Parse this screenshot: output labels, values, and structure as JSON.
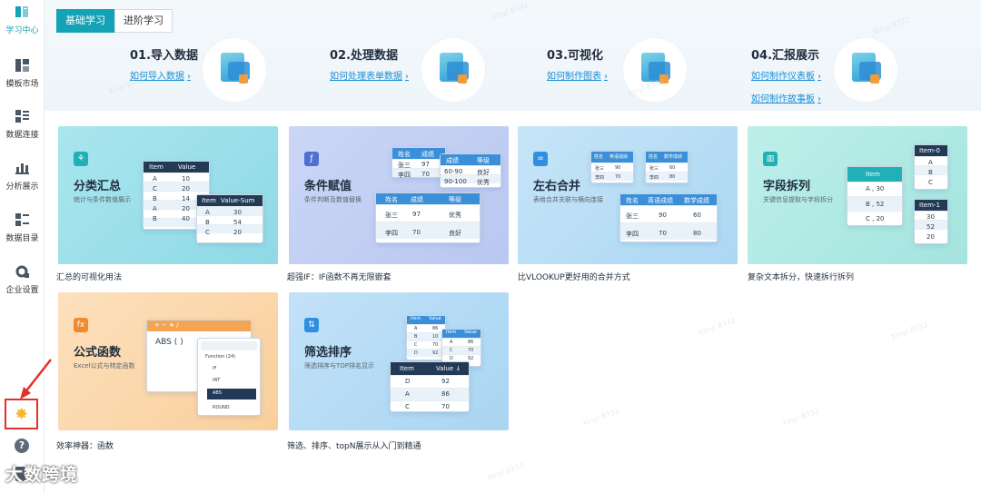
{
  "sidebar": {
    "items": [
      {
        "label": "学习中心",
        "icon": "book-icon",
        "active": true
      },
      {
        "label": "模板市场",
        "icon": "grid-icon",
        "active": false
      },
      {
        "label": "数据连接",
        "icon": "database-icon",
        "active": false
      },
      {
        "label": "分析展示",
        "icon": "chart-icon",
        "active": false
      },
      {
        "label": "数据目录",
        "icon": "list-icon",
        "active": false
      },
      {
        "label": "企业设置",
        "icon": "gear-icon",
        "active": false
      }
    ],
    "star_icon": "star-icon",
    "help_icon": "help-icon",
    "doc_icon": "document-icon"
  },
  "tabs": [
    {
      "label": "基础学习",
      "active": true
    },
    {
      "label": "进阶学习",
      "active": false
    }
  ],
  "steps": [
    {
      "title": "01.导入数据",
      "links": [
        "如何导入数据"
      ]
    },
    {
      "title": "02.处理数据",
      "links": [
        "如何处理表单数据"
      ]
    },
    {
      "title": "03.可视化",
      "links": [
        "如何制作图表"
      ]
    },
    {
      "title": "04.汇报展示",
      "links": [
        "如何制作仪表板",
        "如何制作故事板"
      ]
    }
  ],
  "cards": [
    {
      "title": "分类汇总",
      "subtitle": "统计与条件数值展示",
      "caption": "汇总的可视化用法",
      "badge": "⚘",
      "accent": "#20b0b5",
      "bg": "#9fe0e9",
      "tables": {
        "t1": {
          "headers": [
            "Item",
            "Value"
          ],
          "rows": [
            [
              "A",
              "10"
            ],
            [
              "C",
              "20"
            ],
            [
              "B",
              "14"
            ],
            [
              "A",
              "20"
            ],
            [
              "B",
              "40"
            ]
          ]
        },
        "t2": {
          "headers": [
            "Item",
            "Value-Sum"
          ],
          "rows": [
            [
              "A",
              "30"
            ],
            [
              "B",
              "54"
            ],
            [
              "C",
              "20"
            ]
          ]
        }
      }
    },
    {
      "title": "条件赋值",
      "subtitle": "条件判断及数值替换",
      "caption": "超强IF：IF函数不再无限嵌套",
      "badge": "f",
      "accent": "#4f6fd1",
      "bg": "#c5d2f5",
      "tables": {
        "t1": {
          "headers": [
            "姓名",
            "成绩"
          ],
          "rows": [
            [
              "张三",
              "97"
            ],
            [
              "李四",
              "70"
            ]
          ]
        },
        "t2": {
          "headers": [
            "成绩",
            "等级"
          ],
          "rows": [
            [
              "60-90",
              "良好"
            ],
            [
              "90-100",
              "优秀"
            ]
          ]
        },
        "t3": {
          "headers": [
            "姓名",
            "成绩",
            "等级"
          ],
          "rows": [
            [
              "张三",
              "97",
              "优秀"
            ],
            [
              "李四",
              "70",
              "良好"
            ]
          ]
        }
      }
    },
    {
      "title": "左右合并",
      "subtitle": "表格合并关联与横向连接",
      "caption": "比VLOOKUP更好用的合并方式",
      "badge": "∞",
      "accent": "#2f8fe0",
      "bg": "#bfe0f7",
      "tables": {
        "t1": {
          "headers": [
            "姓名",
            "英语成绩"
          ],
          "rows": [
            [
              "张三",
              "90"
            ],
            [
              "李四",
              "70"
            ]
          ]
        },
        "t2": {
          "headers": [
            "姓名",
            "数学成绩"
          ],
          "rows": [
            [
              "张三",
              "60"
            ],
            [
              "李四",
              "80"
            ]
          ]
        },
        "t3": {
          "headers": [
            "姓名",
            "英语成绩",
            "数学成绩"
          ],
          "rows": [
            [
              "张三",
              "90",
              "60"
            ],
            [
              "李四",
              "70",
              "80"
            ]
          ]
        }
      }
    },
    {
      "title": "字段拆列",
      "subtitle": "关键信息提取与字段拆分",
      "caption": "复杂文本拆分，快速拆行拆列",
      "badge": "▥",
      "accent": "#20b0b5",
      "bg": "#b4ece6",
      "tables": {
        "t1": {
          "headers": [
            "Item"
          ],
          "rows": [
            [
              "A , 30"
            ],
            [
              "B , 52"
            ],
            [
              "C , 20"
            ]
          ]
        },
        "t2": {
          "headers": [
            "Item-0"
          ],
          "rows": [
            [
              "A"
            ],
            [
              "B"
            ],
            [
              "C"
            ]
          ]
        },
        "t3": {
          "headers": [
            "Item-1"
          ],
          "rows": [
            [
              "30"
            ],
            [
              "52"
            ],
            [
              "20"
            ]
          ]
        }
      }
    },
    {
      "title": "公式函数",
      "subtitle": "Excel公式与特定函数",
      "caption": "效率神器：函数",
      "badge": "fx",
      "accent": "#f08a2c",
      "bg": "#fcd9b0",
      "formula": {
        "ops": "+ − ∗ /",
        "expr": "ABS ( )",
        "group": "Function (24)",
        "items": [
          "IF",
          "INT",
          "ABS",
          "ROUND"
        ],
        "selected": "ABS"
      }
    },
    {
      "title": "筛选排序",
      "subtitle": "筛选排序与TOP排名显示",
      "caption": "筛选、排序、topN展示从入门到精通",
      "badge": "⇅",
      "accent": "#2f8fe0",
      "bg": "#b9ddf6",
      "tables": {
        "t1": {
          "headers": [
            "Item",
            "Value"
          ],
          "rows": [
            [
              "A",
              "86"
            ],
            [
              "B",
              "10"
            ],
            [
              "C",
              "70"
            ],
            [
              "D",
              "92"
            ]
          ]
        },
        "t2": {
          "headers": [
            "Item",
            "Value"
          ],
          "rows": [
            [
              "A",
              "86"
            ],
            [
              "C",
              "70"
            ],
            [
              "D",
              "92"
            ]
          ]
        },
        "t3": {
          "headers": [
            "Item",
            "Value ↓"
          ],
          "rows": [
            [
              "D",
              "92"
            ],
            [
              "A",
              "86"
            ],
            [
              "C",
              "70"
            ]
          ]
        }
      }
    }
  ],
  "watermark": "Xinyi 8332",
  "brand": "大数跨境"
}
